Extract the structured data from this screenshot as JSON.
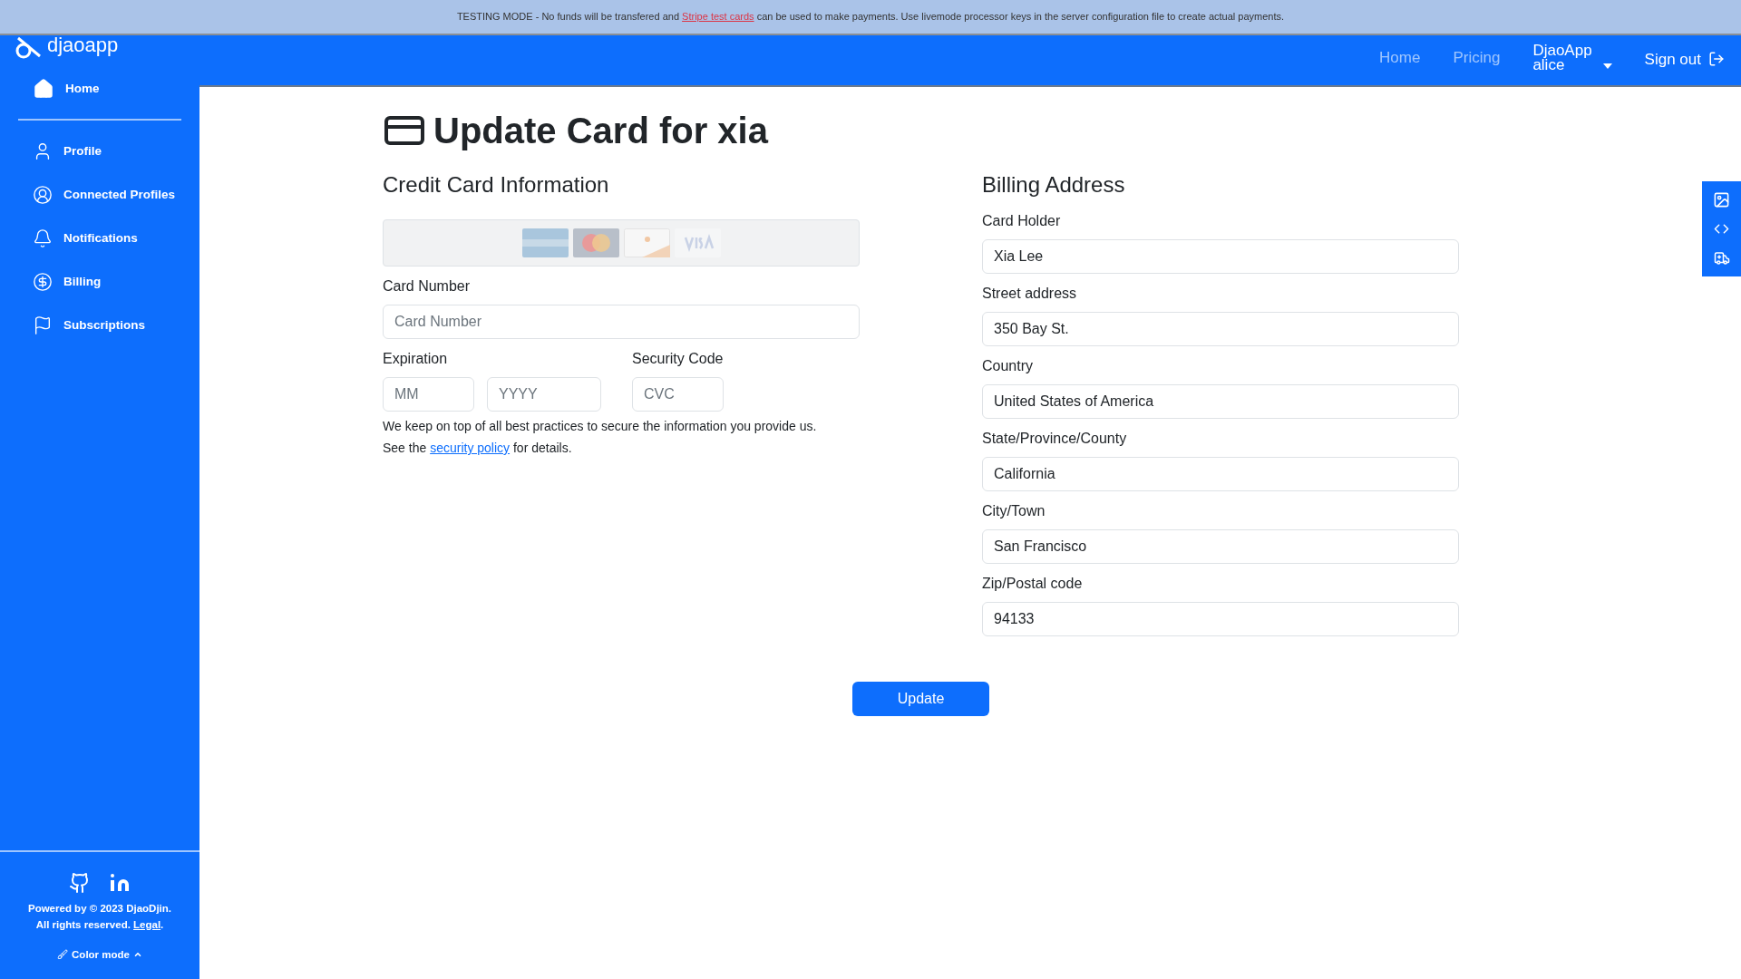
{
  "banner": {
    "before": "TESTING MODE - No funds will be transfered and",
    "link": "Stripe test cards",
    "after": "can be used to make payments. Use livemode processor keys in the server configuration file to create actual payments."
  },
  "sidebar": {
    "logo": "djaoapp",
    "items": [
      {
        "label": "Home"
      },
      {
        "label": "Profile"
      },
      {
        "label": "Connected Profiles"
      },
      {
        "label": "Notifications"
      },
      {
        "label": "Billing"
      },
      {
        "label": "Subscriptions"
      }
    ],
    "footer": {
      "powered": "Powered by © 2023 DjaoDjin.",
      "rights": "All rights reserved.",
      "legal": "Legal",
      "legal_end": ".",
      "color_mode": "Color mode"
    }
  },
  "topnav": {
    "links": [
      "Home",
      "Pricing"
    ],
    "user": {
      "app": "DjaoApp",
      "name": "alice"
    },
    "sign_out": "Sign out"
  },
  "page": {
    "title": "Update Card for xia",
    "card": {
      "heading": "Credit Card Information",
      "number_label": "Card Number",
      "number_placeholder": "Card Number",
      "expiration_label": "Expiration",
      "month_placeholder": "MM",
      "year_placeholder": "YYYY",
      "code_label": "Security Code",
      "code_placeholder": "CVC",
      "note": "We keep on top of all best practices to secure the information you provide us.",
      "see": "See the",
      "policy": "security policy",
      "details": "for details."
    },
    "billing": {
      "heading": "Billing Address",
      "fields": [
        {
          "label": "Card Holder",
          "value": "Xia Lee"
        },
        {
          "label": "Street address",
          "value": "350 Bay St."
        },
        {
          "label": "Country",
          "value": "United States of America"
        },
        {
          "label": "State/Province/County",
          "value": "California"
        },
        {
          "label": "City/Town",
          "value": "San Francisco"
        },
        {
          "label": "Zip/Postal code",
          "value": "94133"
        }
      ]
    },
    "submit": "Update"
  }
}
